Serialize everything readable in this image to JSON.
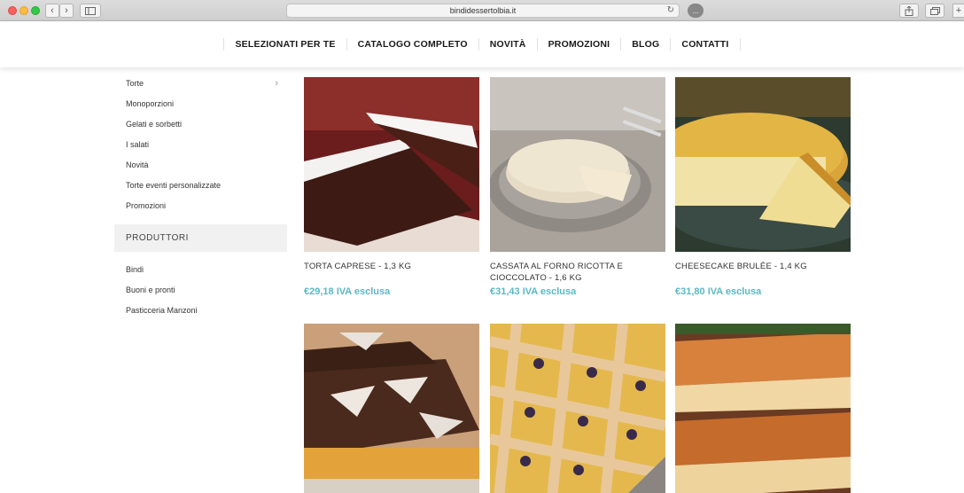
{
  "browser": {
    "url": "bindidessertolbia.it",
    "ext_label": "..."
  },
  "nav": {
    "items": [
      "SELEZIONATI PER TE",
      "CATALOGO COMPLETO",
      "NOVITÀ",
      "PROMOZIONI",
      "BLOG",
      "CONTATTI"
    ]
  },
  "sidebar": {
    "categories": [
      "Torte",
      "Monoporzioni",
      "Gelati e sorbetti",
      "I salati",
      "Novità",
      "Torte eventi personalizzate",
      "Promozioni"
    ],
    "producers_title": "PRODUTTORI",
    "producers": [
      "Bindi",
      "Buoni e pronti",
      "Pasticceria Manzoni"
    ]
  },
  "products": [
    {
      "name": "TORTA CAPRESE - 1,3 KG",
      "price": "€29,18 IVA esclusa",
      "image": "chocolate-cake-slice"
    },
    {
      "name": "CASSATA AL FORNO RICOTTA E CIOCCOLATO - 1,6 KG",
      "price": "€31,43 IVA esclusa",
      "image": "baked-cassata-tart"
    },
    {
      "name": "CHEESECAKE BRULÉE - 1,4 KG",
      "price": "€31,80 IVA esclusa",
      "image": "cheesecake-brulee"
    },
    {
      "name": "",
      "price": "",
      "image": "chocolate-diamond-tart"
    },
    {
      "name": "",
      "price": "",
      "image": "berry-lattice-crostata"
    },
    {
      "name": "",
      "price": "",
      "image": "custard-pastry-slices"
    }
  ],
  "colors": {
    "price": "#5bb8c3",
    "accent_nav": "#1a1a1a"
  }
}
